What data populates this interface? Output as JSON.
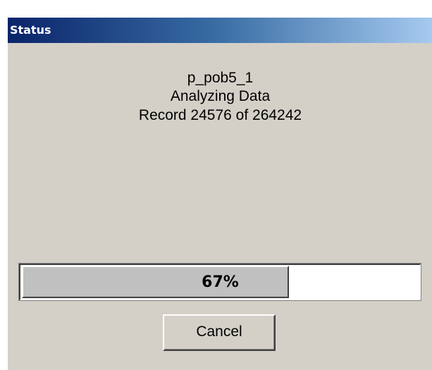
{
  "window": {
    "title": "Status"
  },
  "message": {
    "name": "p_pob5_1",
    "action": "Analyzing Data",
    "record": "Record 24576 of 264242"
  },
  "progress": {
    "label": "67%",
    "fraction": 0.67
  },
  "buttons": {
    "cancel": "Cancel"
  },
  "colors": {
    "titlebar_start": "#0a246a",
    "titlebar_end": "#a6caf0",
    "dialog_face": "#d4d0c8",
    "progress_fill": "#c0c0c0"
  }
}
